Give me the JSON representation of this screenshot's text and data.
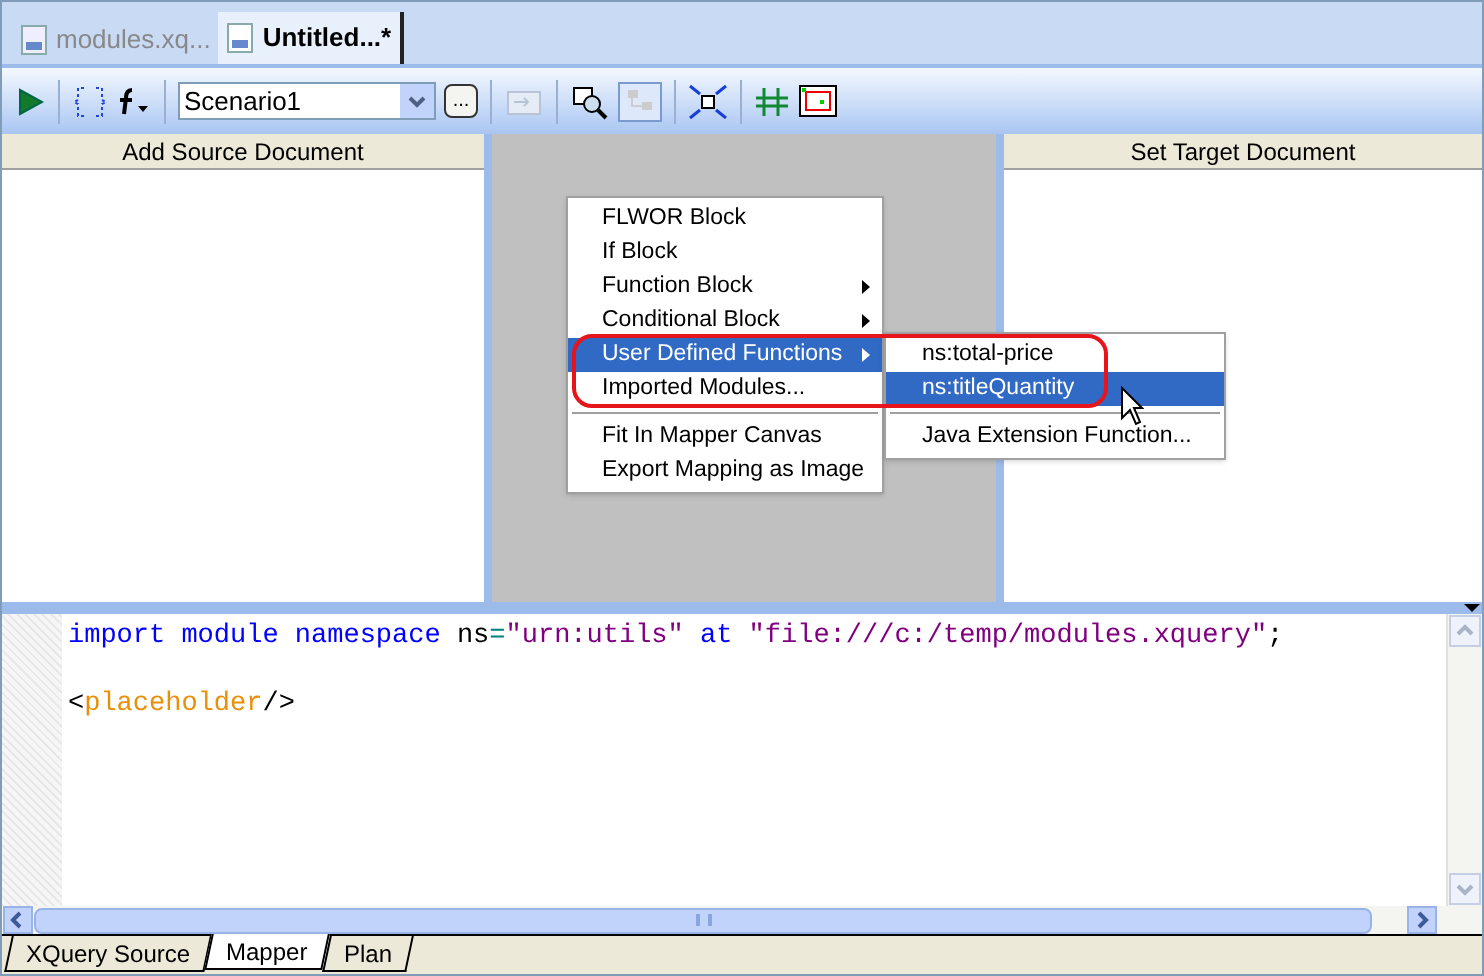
{
  "tabs": [
    {
      "label": "modules.xq...",
      "selected": false
    },
    {
      "label": "Untitled...*",
      "selected": true
    }
  ],
  "toolbar": {
    "scenario": "Scenario1",
    "browse_button": "..."
  },
  "source_panel": {
    "header": "Add Source Document"
  },
  "target_panel": {
    "header": "Set Target Document"
  },
  "context_menu": {
    "items": [
      {
        "kind": "item",
        "label": "FLWOR Block",
        "submenu": false,
        "selected": false
      },
      {
        "kind": "item",
        "label": "If Block",
        "submenu": false,
        "selected": false
      },
      {
        "kind": "item",
        "label": "Function Block",
        "submenu": true,
        "selected": false
      },
      {
        "kind": "item",
        "label": "Conditional Block",
        "submenu": true,
        "selected": false
      },
      {
        "kind": "item",
        "label": "User Defined Functions",
        "submenu": true,
        "selected": true
      },
      {
        "kind": "item",
        "label": "Imported Modules...",
        "submenu": false,
        "selected": false
      },
      {
        "kind": "separator"
      },
      {
        "kind": "item",
        "label": "Fit In Mapper Canvas",
        "submenu": false,
        "selected": false
      },
      {
        "kind": "item",
        "label": "Export Mapping as Image",
        "submenu": false,
        "selected": false
      }
    ]
  },
  "submenu": {
    "items": [
      {
        "kind": "item",
        "label": "ns:total-price",
        "selected": false
      },
      {
        "kind": "item",
        "label": "ns:titleQuantity",
        "selected": true
      },
      {
        "kind": "separator"
      },
      {
        "kind": "item",
        "label": "Java Extension Function...",
        "selected": false
      }
    ]
  },
  "code": {
    "lines": [
      [
        {
          "kind": "keyword",
          "text": "import module namespace"
        },
        {
          "kind": "plain",
          "text": " ns"
        },
        {
          "kind": "operator",
          "text": "="
        },
        {
          "kind": "string",
          "text": "\"urn:utils\""
        },
        {
          "kind": "keyword",
          "text": " at "
        },
        {
          "kind": "string",
          "text": "\"file:///c:/temp/modules.xquery\""
        },
        {
          "kind": "plain",
          "text": ";"
        }
      ],
      [
        {
          "kind": "plain",
          "text": "<"
        },
        {
          "kind": "tag",
          "text": "placeholder"
        },
        {
          "kind": "plain",
          "text": "/>"
        }
      ]
    ]
  },
  "bottom_tabs": [
    {
      "label": "XQuery Source",
      "selected": false
    },
    {
      "label": "Mapper",
      "selected": true
    },
    {
      "label": "Plan",
      "selected": false
    }
  ]
}
